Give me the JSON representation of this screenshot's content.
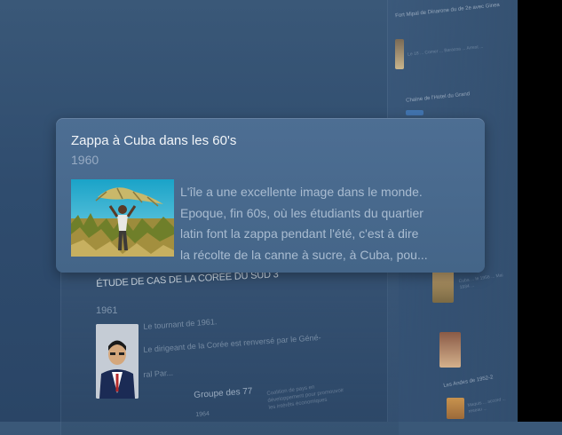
{
  "background_panel": {
    "titles": [
      "Fort Mipal de Dinarone du de 2e avec Ginea",
      "Chaine de l'Hotel du Grand",
      "Les Andes de 1952-2"
    ],
    "snippets": [
      "Le 18 ... Comer ... Baracoa ... Arrest ...",
      "Cuba ... le 1956 ... Mai 1934 ...",
      "Maquis ... accord ... reseau ..."
    ]
  },
  "back_card": {
    "title": "ÉTUDE DE CAS DE LA CORÉE DU SUD 3",
    "year": "1961",
    "paragraph_1": "Le tournant de 1961.",
    "paragraph_2": "Le dirigeant de la Corée est renversé par le Géné-",
    "paragraph_3": "ral Par...",
    "subtitle": "Groupe des 77",
    "sub_year": "1964",
    "sub_text": "Coalition de pays en développement pour promouvoir les intérêts économiques"
  },
  "card": {
    "title": "Zappa à Cuba dans les 60's",
    "year": "1960",
    "description_lines": [
      "L'île a une excellente image dans le monde.",
      "Epoque, fin 60s, où les étudiants du quartier",
      "latin font la zappa pendant l'été, c'est à dire",
      "la récolte de la canne à sucre, à Cuba, pou..."
    ]
  },
  "colors": {
    "background": "#2f4c6e",
    "card": "#4a6b90",
    "card_title": "#f2f5f9",
    "card_muted": "#a9bcd1"
  }
}
